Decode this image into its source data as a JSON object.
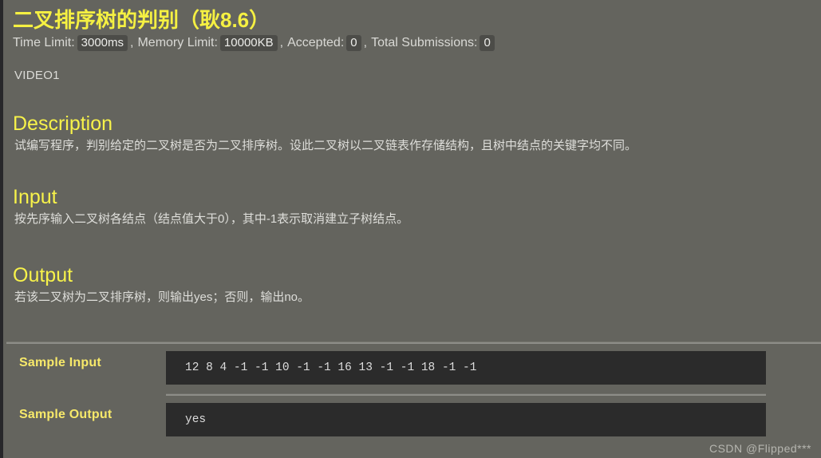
{
  "colors": {
    "page_background": "#64645e",
    "heading_yellow": "#f7f24a",
    "title_yellow": "#f5f042",
    "sample_label_yellow": "#f7e96a",
    "body_text": "#dededa",
    "code_background": "#2b2b2b",
    "code_text": "#dcdcdc",
    "badge_background": "#4c4c48",
    "divider": "#8d8d88",
    "left_rail": "#27272a"
  },
  "header": {
    "title": "二叉排序树的判别（耿8.6）",
    "meta": {
      "time_limit_label": "Time Limit:",
      "time_limit_value": "3000ms",
      "comma_1": ",",
      "memory_limit_label": "Memory Limit:",
      "memory_limit_value": "10000KB",
      "comma_2": ",",
      "accepted_label": "Accepted:",
      "accepted_value": "0",
      "comma_3": ",",
      "total_submissions_label": "Total Submissions:",
      "total_submissions_value": "0"
    },
    "video_link": "VIDEO1"
  },
  "sections": {
    "description": {
      "heading": "Description",
      "body": "试编写程序，判别给定的二叉树是否为二叉排序树。设此二叉树以二叉链表作存储结构，且树中结点的关键字均不同。"
    },
    "input": {
      "heading": "Input",
      "body": "按先序输入二叉树各结点（结点值大于0），其中-1表示取消建立子树结点。"
    },
    "output": {
      "heading": "Output",
      "body": "若该二叉树为二叉排序树，则输出yes；否则，输出no。"
    }
  },
  "samples": {
    "input": {
      "label": "Sample Input",
      "content": "12 8 4 -1 -1 10 -1 -1 16 13 -1 -1 18 -1 -1"
    },
    "output": {
      "label": "Sample Output",
      "content": "yes"
    }
  },
  "watermark": "CSDN @Flipped***"
}
